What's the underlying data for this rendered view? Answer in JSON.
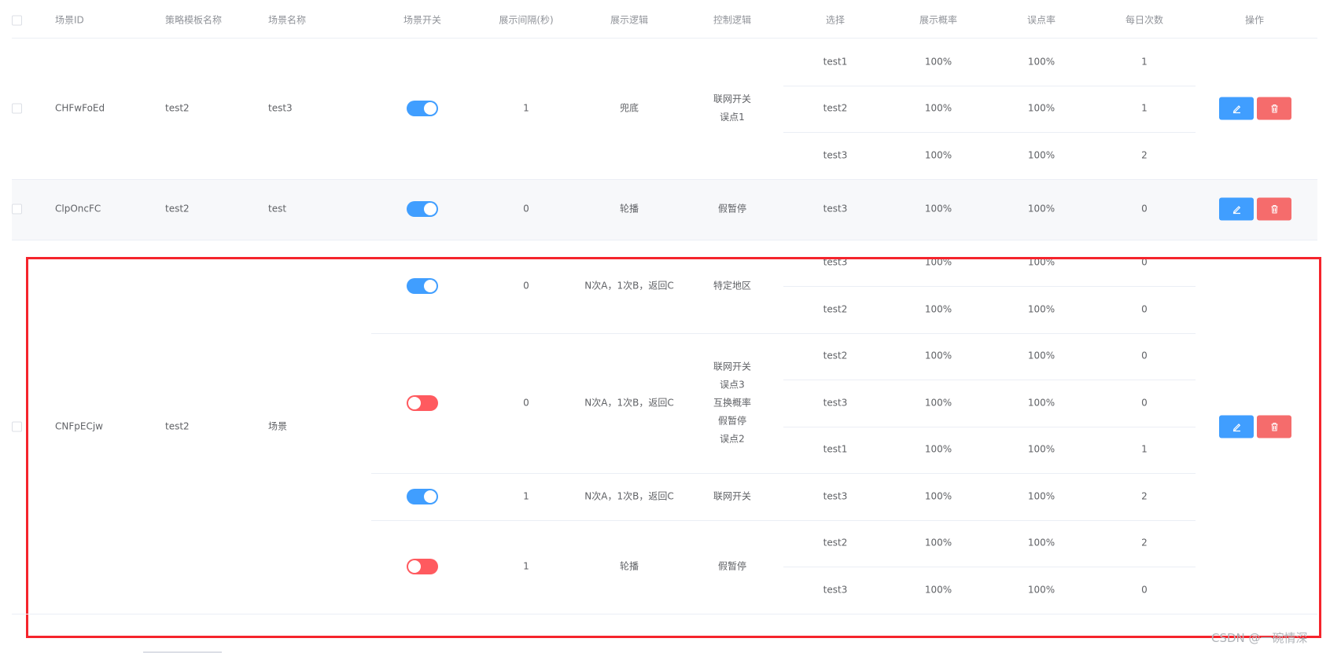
{
  "header": {
    "select_all": "",
    "id": "场景ID",
    "template_name": "策略模板名称",
    "scene_name": "场景名称",
    "switch": "场景开关",
    "interval": "展示间隔(秒)",
    "display_logic": "展示逻辑",
    "control_logic": "控制逻辑",
    "choice": "选择",
    "display_prob": "展示概率",
    "misclick_rate": "误点率",
    "daily_count": "每日次数",
    "action": "操作"
  },
  "rows": [
    {
      "id": "CHFwFoEd",
      "template_name": "test2",
      "scene_name": "test3",
      "groups": [
        {
          "switch_on": true,
          "interval": "1",
          "display_logic": "兜底",
          "control_logic": [
            "联网开关",
            "误点1"
          ],
          "items": [
            {
              "choice": "test1",
              "display_prob": "100%",
              "misclick_rate": "100%",
              "daily_count": "1"
            },
            {
              "choice": "test2",
              "display_prob": "100%",
              "misclick_rate": "100%",
              "daily_count": "1"
            },
            {
              "choice": "test3",
              "display_prob": "100%",
              "misclick_rate": "100%",
              "daily_count": "2"
            }
          ]
        }
      ]
    },
    {
      "id": "ClpOncFC",
      "template_name": "test2",
      "scene_name": "test",
      "groups": [
        {
          "switch_on": true,
          "interval": "0",
          "display_logic": "轮播",
          "control_logic": [
            "假暂停"
          ],
          "items": [
            {
              "choice": "test3",
              "display_prob": "100%",
              "misclick_rate": "100%",
              "daily_count": "0"
            }
          ]
        }
      ]
    },
    {
      "id": "CNFpECjw",
      "template_name": "test2",
      "scene_name": "场景",
      "groups": [
        {
          "switch_on": true,
          "interval": "0",
          "display_logic": "N次A，1次B，返回C",
          "control_logic": [
            "特定地区"
          ],
          "items": [
            {
              "choice": "test3",
              "display_prob": "100%",
              "misclick_rate": "100%",
              "daily_count": "0"
            },
            {
              "choice": "test2",
              "display_prob": "100%",
              "misclick_rate": "100%",
              "daily_count": "0"
            }
          ]
        },
        {
          "switch_on": false,
          "interval": "0",
          "display_logic": "N次A，1次B，返回C",
          "control_logic": [
            "联网开关",
            "误点3",
            "互换概率",
            "假暂停",
            "误点2"
          ],
          "items": [
            {
              "choice": "test2",
              "display_prob": "100%",
              "misclick_rate": "100%",
              "daily_count": "0"
            },
            {
              "choice": "test3",
              "display_prob": "100%",
              "misclick_rate": "100%",
              "daily_count": "0"
            },
            {
              "choice": "test1",
              "display_prob": "100%",
              "misclick_rate": "100%",
              "daily_count": "1"
            }
          ]
        },
        {
          "switch_on": true,
          "interval": "1",
          "display_logic": "N次A，1次B，返回C",
          "control_logic": [
            "联网开关"
          ],
          "items": [
            {
              "choice": "test3",
              "display_prob": "100%",
              "misclick_rate": "100%",
              "daily_count": "2"
            }
          ]
        },
        {
          "switch_on": false,
          "interval": "1",
          "display_logic": "轮播",
          "control_logic": [
            "假暂停"
          ],
          "items": [
            {
              "choice": "test2",
              "display_prob": "100%",
              "misclick_rate": "100%",
              "daily_count": "2"
            },
            {
              "choice": "test3",
              "display_prob": "100%",
              "misclick_rate": "100%",
              "daily_count": "0"
            }
          ]
        }
      ]
    }
  ],
  "icons": {
    "edit": "edit-icon",
    "delete": "delete-icon"
  },
  "colors": {
    "primary": "#409eff",
    "danger": "#f56c6c",
    "switch_off": "#ff5a5f",
    "highlight": "#f5242c"
  },
  "watermark": "CSDN @一碗情深"
}
